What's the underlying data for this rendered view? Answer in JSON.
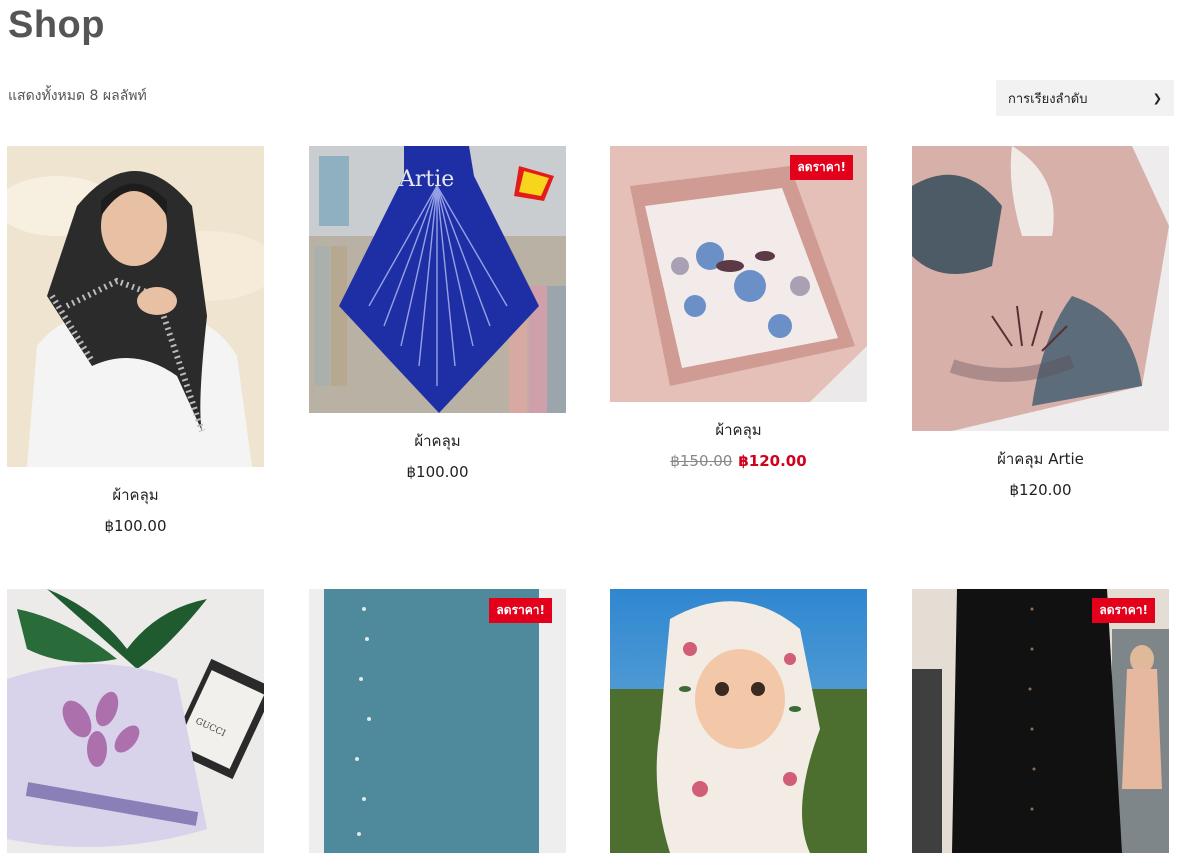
{
  "page": {
    "title": "Shop",
    "result_count": "แสดงทั้งหมด 8 ผลลัพท์"
  },
  "orderby": {
    "selected": "การเรียงลำดับ"
  },
  "sale_label": "ลดราคา!",
  "products": [
    {
      "name": "ผ้าคลุม",
      "price": "฿100.00",
      "image": "woman-black-hijab"
    },
    {
      "name": "ผ้าคลุม",
      "price": "฿100.00",
      "image": "blue-beaded-scarf",
      "logo_text": "Artie"
    },
    {
      "name": "ผ้าคลุม",
      "regular_price": "฿150.00",
      "sale_price": "฿120.00",
      "on_sale": true,
      "image": "floral-silk-scarf"
    },
    {
      "name": "ผ้าคลุม Artie",
      "price": "฿120.00",
      "image": "abstract-pink-scarf"
    },
    {
      "image": "purple-leaf-scarf",
      "box_text": "GUCCI"
    },
    {
      "on_sale": true,
      "image": "teal-beaded-scarf"
    },
    {
      "image": "child-floral-hijab"
    },
    {
      "on_sale": true,
      "image": "black-abaya"
    }
  ],
  "colors": {
    "sale": "#e2001a",
    "sale_price": "#d0021b"
  }
}
